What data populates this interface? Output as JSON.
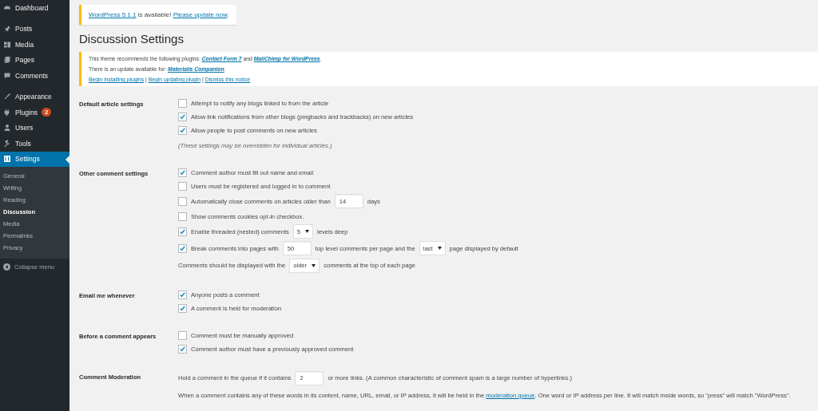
{
  "sidebar": {
    "items": [
      {
        "label": "Dashboard",
        "selected": false
      },
      {
        "label": "Posts",
        "selected": false
      },
      {
        "label": "Media",
        "selected": false
      },
      {
        "label": "Pages",
        "selected": false
      },
      {
        "label": "Comments",
        "selected": false
      },
      {
        "label": "Appearance",
        "selected": false
      },
      {
        "label": "Plugins",
        "selected": false,
        "badge": "2"
      },
      {
        "label": "Users",
        "selected": false
      },
      {
        "label": "Tools",
        "selected": false
      },
      {
        "label": "Settings",
        "selected": true
      }
    ],
    "submenu": [
      {
        "label": "General",
        "selected": false
      },
      {
        "label": "Writing",
        "selected": false
      },
      {
        "label": "Reading",
        "selected": false
      },
      {
        "label": "Discussion",
        "selected": true
      },
      {
        "label": "Media",
        "selected": false
      },
      {
        "label": "Permalinks",
        "selected": false
      },
      {
        "label": "Privacy",
        "selected": false
      }
    ],
    "collapse": "Collapse menu"
  },
  "update_notice": [
    {
      "kind": "link",
      "text": "WordPress 5.1.1"
    },
    {
      "kind": "text",
      "text": " is available! "
    },
    {
      "kind": "link",
      "text": "Please update now"
    },
    {
      "kind": "text",
      "text": "."
    }
  ],
  "title": "Discussion Settings",
  "plugin_notice": [
    [
      {
        "kind": "text",
        "text": "This theme recommends the following plugins: "
      },
      {
        "kind": "plugin_link",
        "text": "Contact Form 7"
      },
      {
        "kind": "text",
        "text": " and "
      },
      {
        "kind": "plugin_link",
        "text": "MailChimp for WordPress"
      },
      {
        "kind": "text",
        "text": "."
      }
    ],
    [
      {
        "kind": "text",
        "text": "There is an update available for: "
      },
      {
        "kind": "plugin_link",
        "text": "Materialis Companion"
      },
      {
        "kind": "text",
        "text": "."
      }
    ],
    [
      {
        "kind": "link",
        "text": "Begin installing plugins"
      },
      {
        "kind": "text",
        "text": " | "
      },
      {
        "kind": "link",
        "text": "Begin updating plugin"
      },
      {
        "kind": "text",
        "text": " | "
      },
      {
        "kind": "link",
        "text": "Dismiss this notice"
      }
    ]
  ],
  "sections": [
    {
      "label": "Default article settings",
      "rows": [
        {
          "kind": "checkbox",
          "checked": false,
          "parts": [
            {
              "kind": "text",
              "text": "Attempt to notify any blogs linked to from the article"
            }
          ]
        },
        {
          "kind": "checkbox",
          "checked": true,
          "parts": [
            {
              "kind": "text",
              "text": "Allow link notifications from other blogs (pingbacks and trackbacks) on new articles"
            }
          ]
        },
        {
          "kind": "checkbox",
          "checked": true,
          "parts": [
            {
              "kind": "text",
              "text": "Allow people to post comments on new articles"
            }
          ]
        },
        {
          "kind": "note",
          "parts": [
            {
              "kind": "text",
              "text": "(These settings may be overridden for individual articles.)"
            }
          ]
        }
      ]
    },
    {
      "label": "Other comment settings",
      "rows": [
        {
          "kind": "checkbox",
          "checked": true,
          "parts": [
            {
              "kind": "text",
              "text": "Comment author must fill out name and email"
            }
          ]
        },
        {
          "kind": "checkbox",
          "checked": false,
          "parts": [
            {
              "kind": "text",
              "text": "Users must be registered and logged in to comment"
            }
          ]
        },
        {
          "kind": "checkbox",
          "checked": false,
          "parts": [
            {
              "kind": "text",
              "text": "Automatically close comments on articles older than"
            },
            {
              "kind": "input",
              "value": "14"
            },
            {
              "kind": "text",
              "text": "days"
            }
          ]
        },
        {
          "kind": "checkbox",
          "checked": false,
          "parts": [
            {
              "kind": "text",
              "text": "Show comments cookies opt-in checkbox."
            }
          ]
        },
        {
          "kind": "checkbox",
          "checked": true,
          "parts": [
            {
              "kind": "text",
              "text": "Enable threaded (nested) comments"
            },
            {
              "kind": "select",
              "value": "5"
            },
            {
              "kind": "text",
              "text": "levels deep"
            }
          ]
        },
        {
          "kind": "checkbox",
          "checked": true,
          "parts": [
            {
              "kind": "text",
              "text": "Break comments into pages with"
            },
            {
              "kind": "input",
              "value": "50"
            },
            {
              "kind": "text",
              "text": "top level comments per page and the"
            },
            {
              "kind": "select",
              "value": "last"
            },
            {
              "kind": "text",
              "text": "page displayed by default"
            }
          ]
        },
        {
          "kind": "text",
          "parts": [
            {
              "kind": "text",
              "text": "Comments should be displayed with the"
            },
            {
              "kind": "select",
              "value": "older"
            },
            {
              "kind": "text",
              "text": "comments at the top of each page"
            }
          ]
        }
      ]
    },
    {
      "label": "Email me whenever",
      "rows": [
        {
          "kind": "checkbox",
          "checked": true,
          "parts": [
            {
              "kind": "text",
              "text": "Anyone posts a comment"
            }
          ]
        },
        {
          "kind": "checkbox",
          "checked": true,
          "parts": [
            {
              "kind": "text",
              "text": "A comment is held for moderation"
            }
          ]
        }
      ]
    },
    {
      "label": "Before a comment appears",
      "rows": [
        {
          "kind": "checkbox",
          "checked": false,
          "parts": [
            {
              "kind": "text",
              "text": "Comment must be manually approved"
            }
          ]
        },
        {
          "kind": "checkbox",
          "checked": true,
          "parts": [
            {
              "kind": "text",
              "text": "Comment author must have a previously approved comment"
            }
          ]
        }
      ]
    },
    {
      "label": "Comment Moderation",
      "rows": [
        {
          "kind": "text",
          "parts": [
            {
              "kind": "text",
              "text": "Hold a comment in the queue if it contains"
            },
            {
              "kind": "input",
              "value": "2"
            },
            {
              "kind": "text",
              "text": "or more links. (A common characteristic of comment spam is a large number of hyperlinks.)"
            }
          ]
        },
        {
          "kind": "text",
          "parts": [
            {
              "kind": "text",
              "text": "When a comment contains any of these words in its content, name, URL, email, or IP address, it will be held in the "
            },
            {
              "kind": "link",
              "text": "moderation queue"
            },
            {
              "kind": "text",
              "text": ". One word or IP address per line. It will match inside words, so \"press\" will match \"WordPress\"."
            }
          ]
        }
      ]
    }
  ]
}
